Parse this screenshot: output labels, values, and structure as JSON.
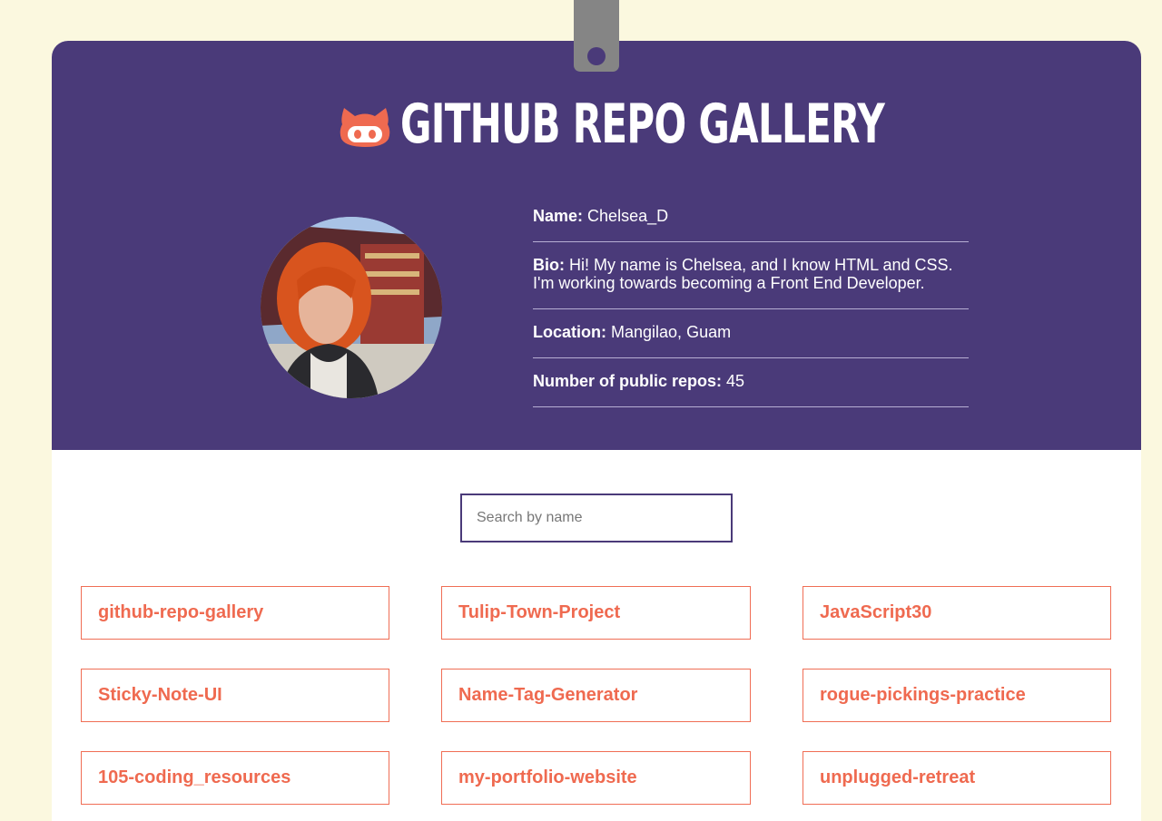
{
  "header": {
    "title": "GitHub Repo Gallery",
    "icon": "github-cat-icon",
    "accent_color": "#ef6a50",
    "background_color": "#4a3a79"
  },
  "profile": {
    "avatar_alt": "user avatar",
    "name_label": "Name:",
    "name_value": "Chelsea_D",
    "bio_label": "Bio:",
    "bio_value": "Hi! My name is Chelsea, and I know HTML and CSS. I'm working towards becoming a Front End Developer.",
    "location_label": "Location:",
    "location_value": "Mangilao, Guam",
    "repos_label": "Number of public repos:",
    "repos_value": "45"
  },
  "search": {
    "placeholder": "Search by name",
    "value": ""
  },
  "repos": [
    "github-repo-gallery",
    "Tulip-Town-Project",
    "JavaScript30",
    "Sticky-Note-UI",
    "Name-Tag-Generator",
    "rogue-pickings-practice",
    "105-coding_resources",
    "my-portfolio-website",
    "unplugged-retreat"
  ]
}
